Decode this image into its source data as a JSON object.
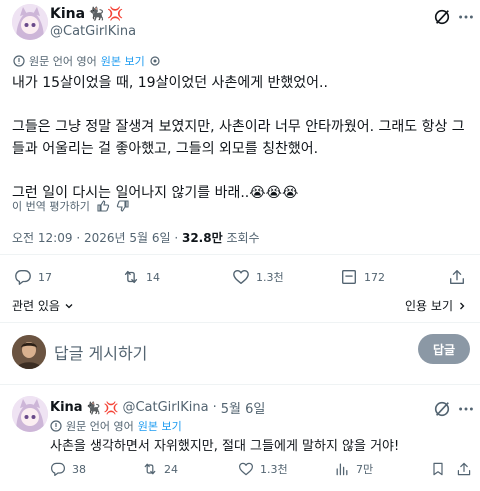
{
  "main_post": {
    "display_name": "Kina",
    "handle": "@CatGirlKina",
    "translate": {
      "label": "원문 언어 영어",
      "link": "원본 보기"
    },
    "paragraphs": [
      "내가 15살이었을 때, 19살이었던 사촌에게 반했었어..",
      "그들은 그냥 정말 잘생겨 보였지만, 사촌이라 너무 안타까웠어. 그래도 항상 그들과 어울리는 걸 좋아했고, 그들의 외모를 칭찬했어.",
      "그런 일이 다시는 일어나지 않기를 바래..😭😭😭"
    ],
    "rate_label": "이 번역 평가하기",
    "meta": {
      "time": "오전 12:09",
      "date": "2026년 5월 6일",
      "views": "32.8만",
      "views_label": "조회수"
    },
    "actions": {
      "replies": "17",
      "reposts": "14",
      "likes": "1.3천",
      "bookmarks": "172"
    },
    "related_label": "관련 있음",
    "quotes_label": "인용 보기"
  },
  "composer": {
    "placeholder": "답글 게시하기",
    "button": "답글"
  },
  "reply_post": {
    "display_name": "Kina",
    "handle": "@CatGirlKina",
    "date": "5월 6일",
    "translate": {
      "label": "원문 언어 영어",
      "link": "원본 보기"
    },
    "text": "사촌을 생각하면서 자위했지만, 절대 그들에게 말하지 않을 거야!",
    "actions": {
      "replies": "38",
      "reposts": "24",
      "likes": "1.3천",
      "views": "7만"
    }
  },
  "colors": {
    "text": "#0f1419",
    "secondary": "#536471",
    "link": "#1d9bf0",
    "divider": "#eff3f4",
    "reply_button": "#8b98a5"
  },
  "icons": [
    "cat-icon",
    "anger-icon",
    "grok-icon",
    "more-icon",
    "translate-icon",
    "thumbs-up-icon",
    "thumbs-down-icon",
    "reply-icon",
    "repost-icon",
    "like-icon",
    "bookmark-icon",
    "share-icon",
    "views-icon",
    "chevron-down-icon",
    "chevron-right-icon"
  ]
}
